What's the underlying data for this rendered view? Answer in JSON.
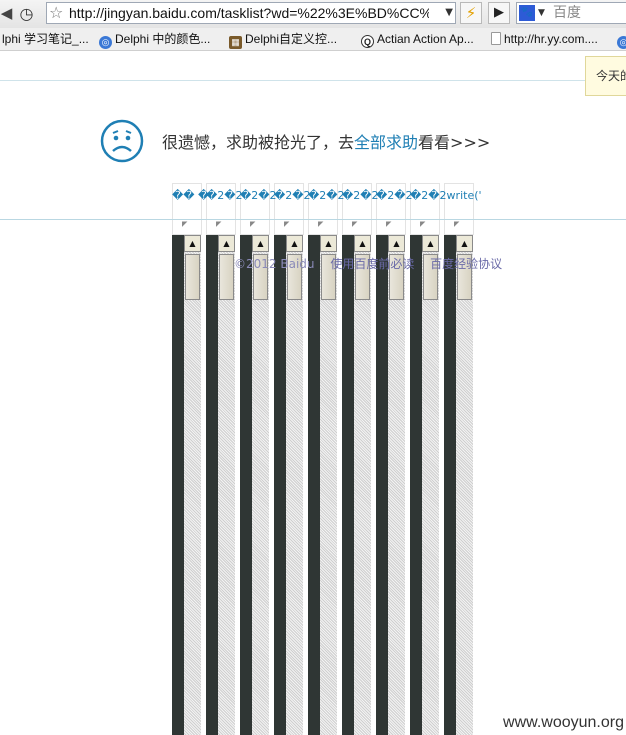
{
  "browser": {
    "url": "http://jingyan.baidu.com/tasklist?wd=%22%3E%BD%CC%D3",
    "search_placeholder": "百度",
    "bookmarks": [
      "lphi 学习笔记_...",
      "Delphi 中的颜色...",
      "Delphi自定义控...",
      "Actian Action Ap...",
      "http://hr.yy.com...."
    ]
  },
  "tooltip": "今天的",
  "message": {
    "prefix": "很遗憾，求助被抢光了，去",
    "link": "全部求助",
    "suffix": "看看>>>"
  },
  "garbled_labels": [
    "��",
    "�",
    "�2�2",
    "�2�2",
    "�2�2",
    "�2�2",
    "�2�2",
    "�2�2",
    "�2�2write('"
  ],
  "footer": {
    "copyright": "©2012 Baidu",
    "links": [
      "使用百度前必读",
      "百度经验协议"
    ]
  },
  "watermark": "www.wooyun.org",
  "colors": {
    "link": "#1f7fb4",
    "frame_dark": "#2f3634",
    "footer_link": "#6a6aa8"
  },
  "icons": [
    "back-icon",
    "history-icon",
    "star-icon",
    "dropdown-icon",
    "bolt-icon",
    "play-icon",
    "baidu-search-icon",
    "sad-face-icon"
  ]
}
